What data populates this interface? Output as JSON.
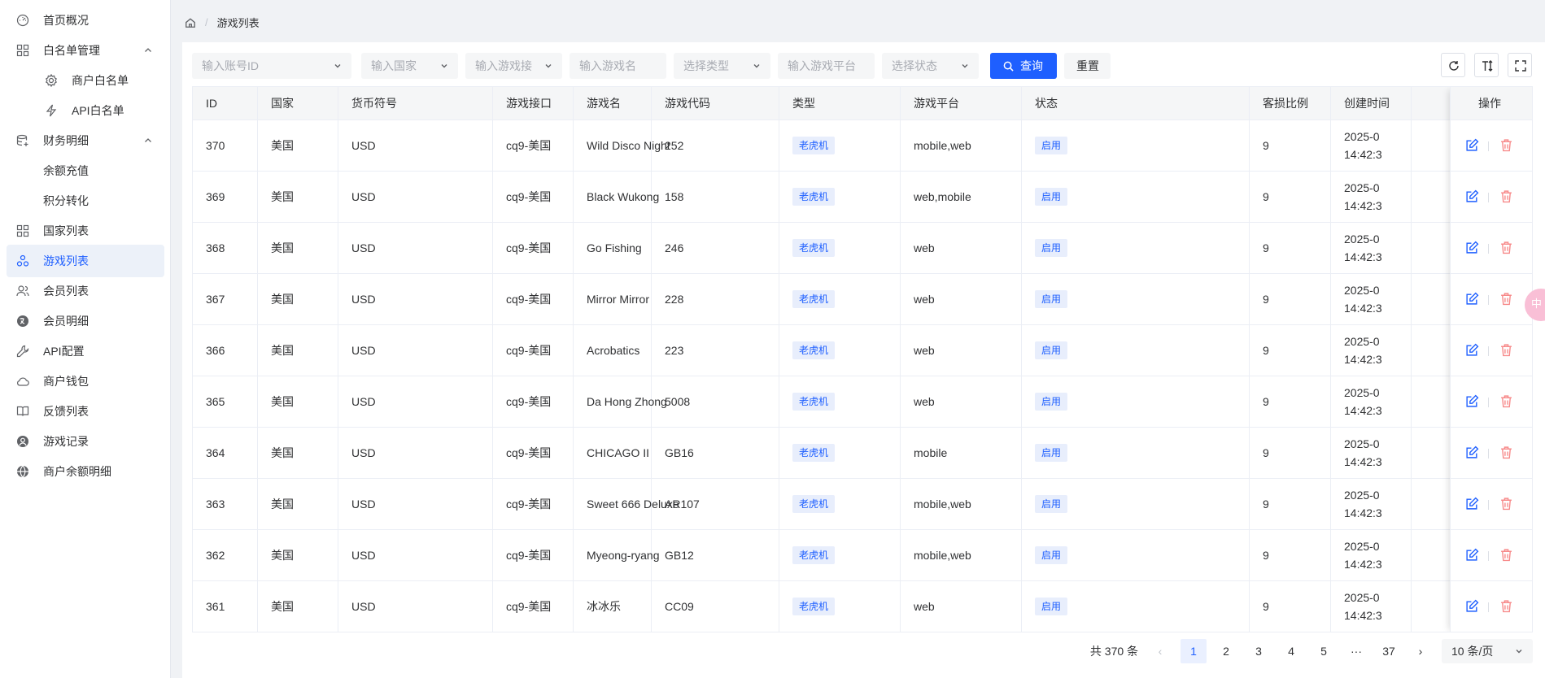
{
  "sidebar": {
    "items": [
      {
        "label": "首页概况",
        "icon": "dashboard-icon"
      },
      {
        "label": "白名单管理",
        "icon": "grid-icon"
      },
      {
        "label": "商户白名单",
        "icon": "gear-icon"
      },
      {
        "label": "API白名单",
        "icon": "lightning-icon"
      },
      {
        "label": "财务明细",
        "icon": "database-icon"
      },
      {
        "label": "余额充值"
      },
      {
        "label": "积分转化"
      },
      {
        "label": "国家列表",
        "icon": "grid-icon"
      },
      {
        "label": "游戏列表",
        "icon": "cluster-icon"
      },
      {
        "label": "会员列表",
        "icon": "users-icon"
      },
      {
        "label": "会员明细",
        "icon": "translate-icon"
      },
      {
        "label": "API配置",
        "icon": "wrench-icon"
      },
      {
        "label": "商户钱包",
        "icon": "cloud-icon"
      },
      {
        "label": "反馈列表",
        "icon": "book-icon"
      },
      {
        "label": "游戏记录",
        "icon": "user-circle-icon"
      },
      {
        "label": "商户余额明细",
        "icon": "globe-icon"
      }
    ],
    "active": "游戏列表"
  },
  "breadcrumb": {
    "current": "游戏列表"
  },
  "filters": {
    "account_id": "输入账号ID",
    "country": "输入国家",
    "game_api": "输入游戏接",
    "game_name": "输入游戏名",
    "type": "选择类型",
    "platform": "输入游戏平台",
    "status": "选择状态"
  },
  "buttons": {
    "query": "查询",
    "reset": "重置"
  },
  "table": {
    "columns": [
      "ID",
      "国家",
      "货币符号",
      "游戏接口",
      "游戏名",
      "游戏代码",
      "类型",
      "游戏平台",
      "状态",
      "客损比例",
      "创建时间",
      "操作"
    ],
    "rows": [
      {
        "id": "370",
        "country": "美国",
        "currency": "USD",
        "api": "cq9-美国",
        "name": "Wild Disco Night",
        "code": "252",
        "type": "老虎机",
        "platform": "mobile,web",
        "status": "启用",
        "ratio": "9",
        "date": "2025-0",
        "time": "14:42:3"
      },
      {
        "id": "369",
        "country": "美国",
        "currency": "USD",
        "api": "cq9-美国",
        "name": "Black Wukong",
        "code": "158",
        "type": "老虎机",
        "platform": "web,mobile",
        "status": "启用",
        "ratio": "9",
        "date": "2025-0",
        "time": "14:42:3"
      },
      {
        "id": "368",
        "country": "美国",
        "currency": "USD",
        "api": "cq9-美国",
        "name": "Go Fishing",
        "code": "246",
        "type": "老虎机",
        "platform": "web",
        "status": "启用",
        "ratio": "9",
        "date": "2025-0",
        "time": "14:42:3"
      },
      {
        "id": "367",
        "country": "美国",
        "currency": "USD",
        "api": "cq9-美国",
        "name": "Mirror Mirror",
        "code": "228",
        "type": "老虎机",
        "platform": "web",
        "status": "启用",
        "ratio": "9",
        "date": "2025-0",
        "time": "14:42:3"
      },
      {
        "id": "366",
        "country": "美国",
        "currency": "USD",
        "api": "cq9-美国",
        "name": "Acrobatics",
        "code": "223",
        "type": "老虎机",
        "platform": "web",
        "status": "启用",
        "ratio": "9",
        "date": "2025-0",
        "time": "14:42:3"
      },
      {
        "id": "365",
        "country": "美国",
        "currency": "USD",
        "api": "cq9-美国",
        "name": "Da Hong Zhong",
        "code": "5008",
        "type": "老虎机",
        "platform": "web",
        "status": "启用",
        "ratio": "9",
        "date": "2025-0",
        "time": "14:42:3"
      },
      {
        "id": "364",
        "country": "美国",
        "currency": "USD",
        "api": "cq9-美国",
        "name": "CHICAGO II",
        "code": "GB16",
        "type": "老虎机",
        "platform": "mobile",
        "status": "启用",
        "ratio": "9",
        "date": "2025-0",
        "time": "14:42:3"
      },
      {
        "id": "363",
        "country": "美国",
        "currency": "USD",
        "api": "cq9-美国",
        "name": "Sweet 666 Deluxe",
        "code": "AR107",
        "type": "老虎机",
        "platform": "mobile,web",
        "status": "启用",
        "ratio": "9",
        "date": "2025-0",
        "time": "14:42:3"
      },
      {
        "id": "362",
        "country": "美国",
        "currency": "USD",
        "api": "cq9-美国",
        "name": "Myeong-ryang",
        "code": "GB12",
        "type": "老虎机",
        "platform": "mobile,web",
        "status": "启用",
        "ratio": "9",
        "date": "2025-0",
        "time": "14:42:3"
      },
      {
        "id": "361",
        "country": "美国",
        "currency": "USD",
        "api": "cq9-美国",
        "name": "冰冰乐",
        "code": "CC09",
        "type": "老虎机",
        "platform": "web",
        "status": "启用",
        "ratio": "9",
        "date": "2025-0",
        "time": "14:42:3"
      }
    ]
  },
  "pagination": {
    "total": "共 370 条",
    "pages": [
      "1",
      "2",
      "3",
      "4",
      "5",
      "···",
      "37"
    ],
    "current": "1",
    "page_size": "10 条/页"
  },
  "float_button": {
    "label": "中"
  },
  "colors": {
    "primary": "#1e5fff",
    "danger": "#f78989",
    "tag_bg": "#e8eefc"
  }
}
